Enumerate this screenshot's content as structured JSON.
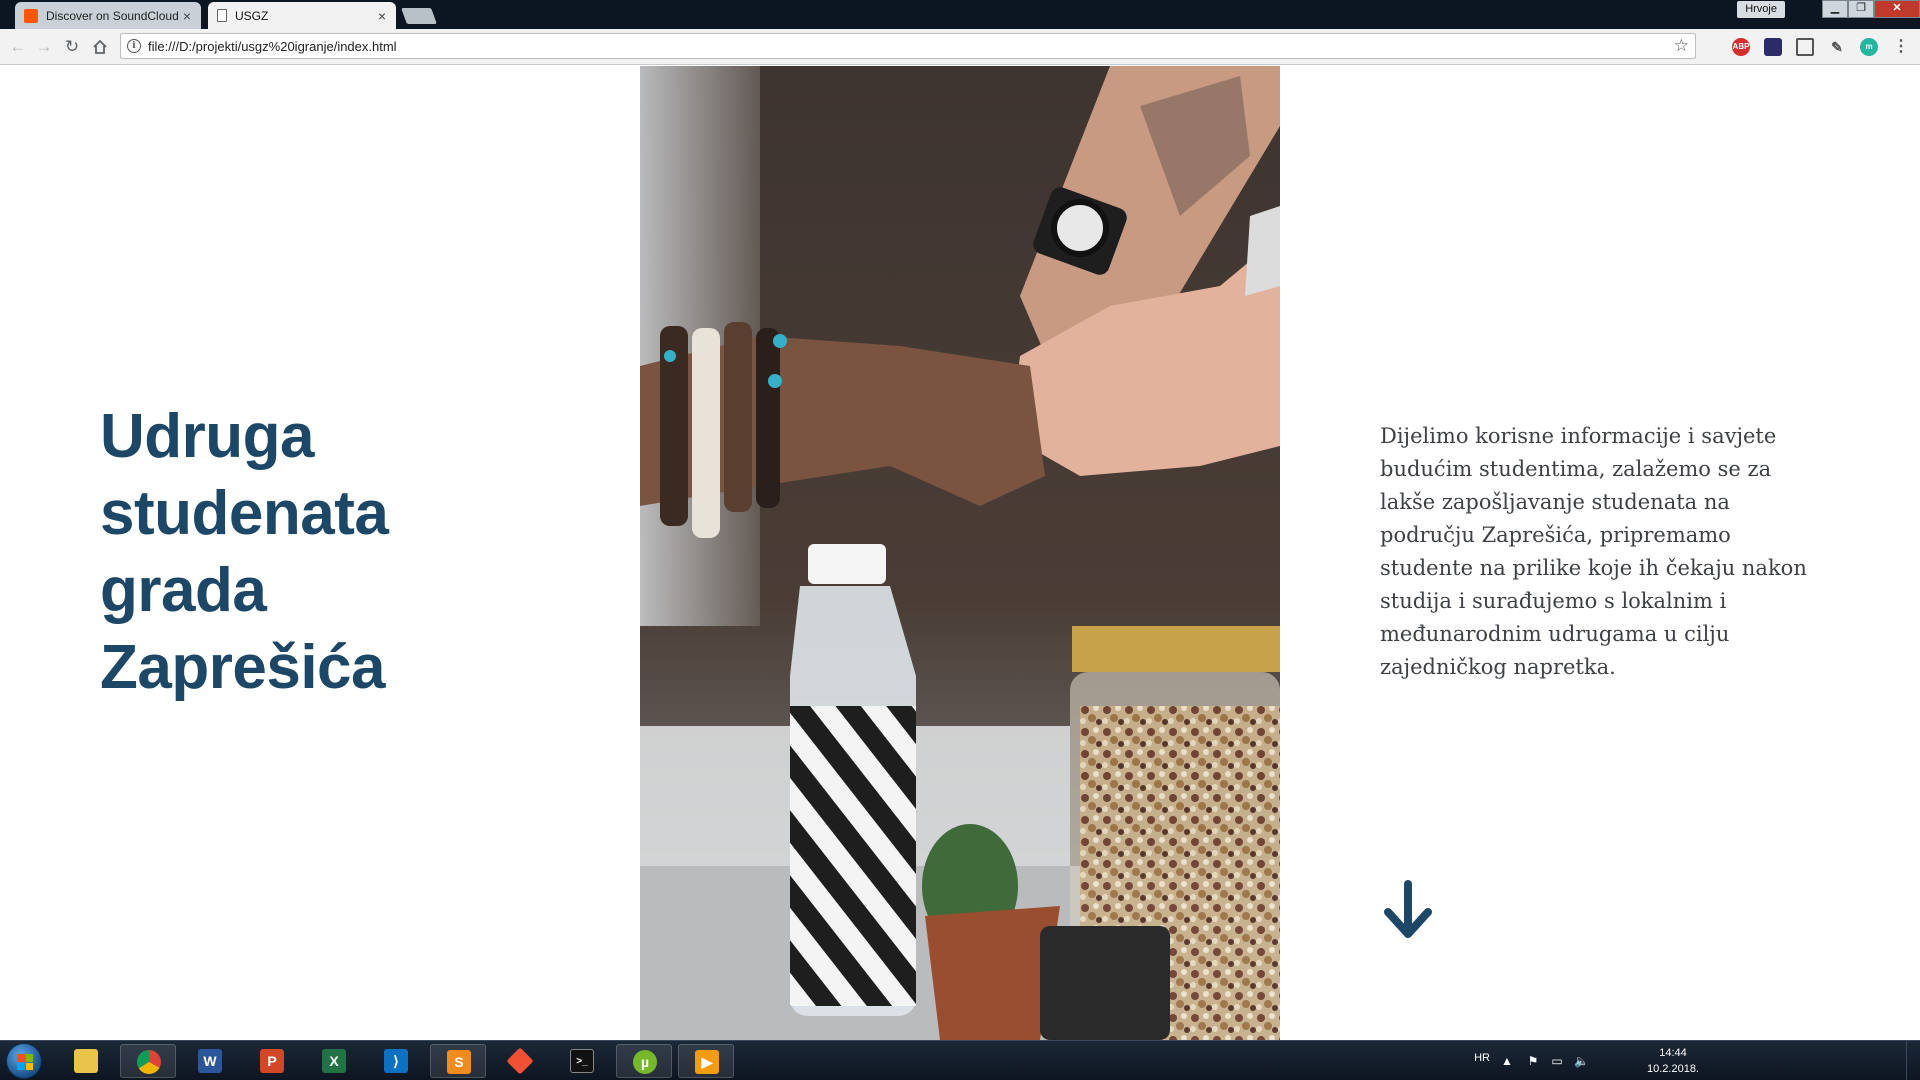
{
  "browser": {
    "tabs": [
      {
        "title": "Discover on SoundCloud",
        "active": false,
        "favicon": "soundcloud-icon"
      },
      {
        "title": "USGZ",
        "active": true,
        "favicon": "document-icon"
      }
    ],
    "url": "file:///D:/projekti/usgz%20igranje/index.html",
    "profile_name": "Hrvoje"
  },
  "page": {
    "headline": "Udruga studenata grada Zaprešića",
    "description": "Dijelimo korisne informacije i savjete budućim studentima, zalažemo se za lakše zapošljavanje studenata na području Zaprešića, pripremamo studente na prilike koje ih čekaju nakon studija i surađujemo s lokalnim i međunarodnim udrugama u cilju zajedničkog napretka.",
    "scroll_icon": "arrow-down-icon",
    "colors": {
      "headline": "#1c4766",
      "text": "#3d4045",
      "background": "#ffffff"
    }
  },
  "taskbar": {
    "apps": [
      "explorer",
      "chrome",
      "word",
      "powerpoint",
      "excel",
      "vscode",
      "sublime-text",
      "git",
      "terminal",
      "utorrent",
      "media-player"
    ],
    "language": "HR",
    "time": "14:44",
    "date": "10.2.2018."
  }
}
